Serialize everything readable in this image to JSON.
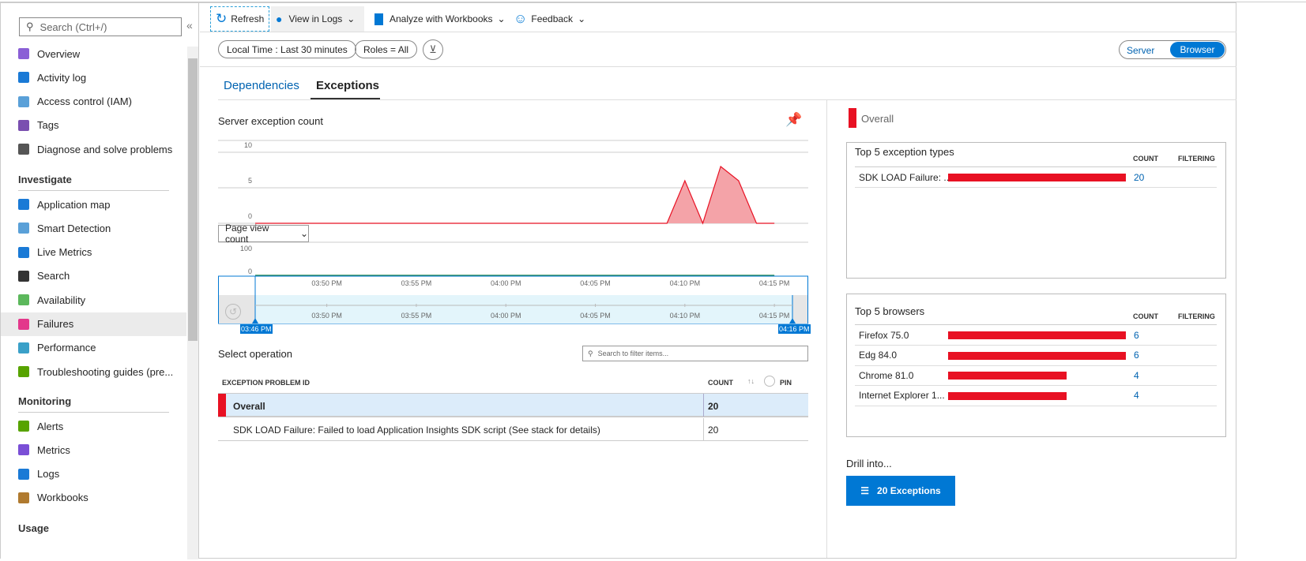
{
  "search": {
    "placeholder": "Search (Ctrl+/)",
    "collapse": "«"
  },
  "sidebar": {
    "items": [
      {
        "label": "Overview",
        "icon": "lightbulb-icon",
        "color": "#8a5fd6"
      },
      {
        "label": "Activity log",
        "icon": "log-icon",
        "color": "#1a7ad6"
      },
      {
        "label": "Access control (IAM)",
        "icon": "people-icon",
        "color": "#5aa0d8"
      },
      {
        "label": "Tags",
        "icon": "tag-icon",
        "color": "#7a4fb0"
      },
      {
        "label": "Diagnose and solve problems",
        "icon": "wrench-icon",
        "color": "#555555"
      }
    ],
    "investigate_title": "Investigate",
    "investigate": [
      {
        "label": "Application map",
        "icon": "app-map-icon",
        "color": "#1a7ad6"
      },
      {
        "label": "Smart Detection",
        "icon": "smart-detection-icon",
        "color": "#5aa0d8"
      },
      {
        "label": "Live Metrics",
        "icon": "pulse-icon",
        "color": "#1a7ad6"
      },
      {
        "label": "Search",
        "icon": "search-icon",
        "color": "#333333"
      },
      {
        "label": "Availability",
        "icon": "globe-icon",
        "color": "#5cb85c"
      },
      {
        "label": "Failures",
        "icon": "failures-icon",
        "color": "#e3378b"
      },
      {
        "label": "Performance",
        "icon": "performance-icon",
        "color": "#3aa0c8"
      },
      {
        "label": "Troubleshooting guides (pre...",
        "icon": "guide-icon",
        "color": "#57a300"
      }
    ],
    "monitoring_title": "Monitoring",
    "monitoring": [
      {
        "label": "Alerts",
        "icon": "alert-icon",
        "color": "#57a300"
      },
      {
        "label": "Metrics",
        "icon": "metrics-icon",
        "color": "#7a4fd6"
      },
      {
        "label": "Logs",
        "icon": "logs-icon",
        "color": "#1a7ad6"
      },
      {
        "label": "Workbooks",
        "icon": "workbook-icon",
        "color": "#b07a2f"
      }
    ],
    "usage_title": "Usage"
  },
  "toolbar": {
    "refresh": "Refresh",
    "view_in_logs": "View in Logs",
    "analyze": "Analyze with Workbooks",
    "feedback": "Feedback"
  },
  "filters": {
    "time": "Local Time : Last 30 minutes",
    "roles": "Roles = All"
  },
  "toggle": {
    "server": "Server",
    "browser": "Browser",
    "selected": "Browser"
  },
  "tabs": {
    "dependencies": "Dependencies",
    "exceptions": "Exceptions",
    "active": "Exceptions"
  },
  "chart_title": "Server exception count",
  "metric_select": "Page view count",
  "chart_data": [
    {
      "type": "area",
      "title": "Server exception count",
      "ylim": [
        0,
        10
      ],
      "yticks": [
        "0",
        "5",
        "10"
      ],
      "x": [
        "03:46",
        "03:47",
        "03:48",
        "03:49",
        "03:50",
        "03:51",
        "03:52",
        "03:53",
        "03:54",
        "03:55",
        "03:56",
        "03:57",
        "03:58",
        "03:59",
        "04:00",
        "04:01",
        "04:02",
        "04:03",
        "04:04",
        "04:05",
        "04:06",
        "04:07",
        "04:08",
        "04:09",
        "04:10",
        "04:11",
        "04:12",
        "04:13",
        "04:14",
        "04:15"
      ],
      "values": [
        0,
        0,
        0,
        0,
        0,
        0,
        0,
        0,
        0,
        0,
        0,
        0,
        0,
        0,
        0,
        0,
        0,
        0,
        0,
        0,
        0,
        0,
        0,
        0,
        6,
        0,
        8,
        6,
        0,
        0
      ],
      "color": "#e81123"
    },
    {
      "type": "line",
      "title": "Page view count",
      "ylim": [
        0,
        100
      ],
      "yticks": [
        "0",
        "100"
      ],
      "values": [
        0,
        0,
        0,
        0,
        0,
        0,
        0,
        0,
        0,
        0,
        0,
        0,
        0,
        0,
        0,
        0,
        0,
        0,
        0,
        0,
        0,
        0,
        0,
        0,
        0,
        0,
        0,
        0,
        0,
        0
      ],
      "color": "#2e8b57"
    }
  ],
  "xticks": [
    "03:50 PM",
    "03:55 PM",
    "04:00 PM",
    "04:05 PM",
    "04:10 PM",
    "04:15 PM"
  ],
  "brush": {
    "start": "03:46 PM",
    "end": "04:16 PM"
  },
  "operation": {
    "title": "Select operation",
    "search_placeholder": "Search to filter items...",
    "columns": {
      "id": "EXCEPTION PROBLEM ID",
      "count": "COUNT",
      "pin": "PIN"
    },
    "rows": [
      {
        "id": "Overall",
        "count": "20"
      },
      {
        "id": "SDK LOAD Failure: Failed to load Application Insights SDK script (See stack for details)",
        "count": "20"
      }
    ]
  },
  "right": {
    "legend": "Overall",
    "exceptions": {
      "title": "Top 5 exception types",
      "count": "COUNT",
      "filtering": "FILTERING",
      "rows": [
        {
          "name": "SDK LOAD Failure: ...",
          "count": "20",
          "value": 20
        }
      ]
    },
    "browsers": {
      "title": "Top 5 browsers",
      "count": "COUNT",
      "filtering": "FILTERING",
      "rows": [
        {
          "name": "Firefox 75.0",
          "count": "6",
          "value": 6
        },
        {
          "name": "Edg 84.0",
          "count": "6",
          "value": 6
        },
        {
          "name": "Chrome 81.0",
          "count": "4",
          "value": 4
        },
        {
          "name": "Internet Explorer 1...",
          "count": "4",
          "value": 4
        }
      ]
    },
    "drill_title": "Drill into...",
    "drill_button": "20 Exceptions"
  }
}
